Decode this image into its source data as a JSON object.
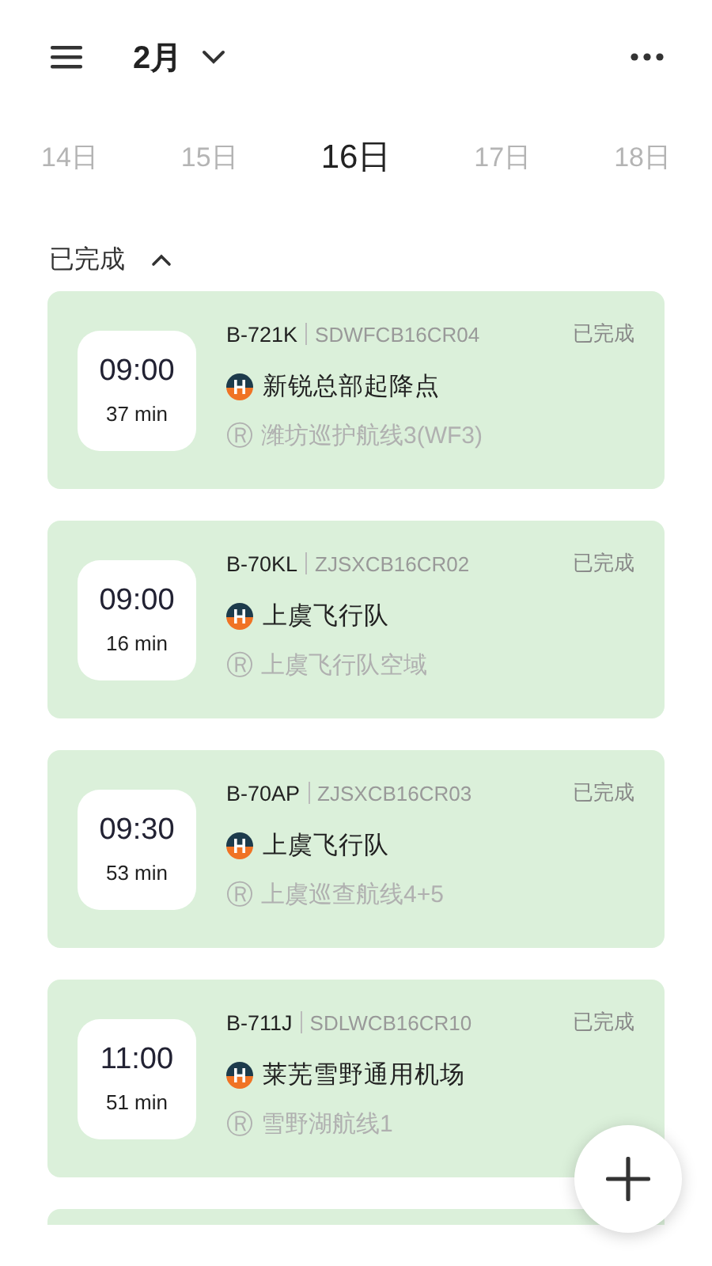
{
  "header": {
    "month": "2月"
  },
  "dates": [
    {
      "label": "14日",
      "selected": false
    },
    {
      "label": "15日",
      "selected": false
    },
    {
      "label": "16日",
      "selected": true
    },
    {
      "label": "17日",
      "selected": false
    },
    {
      "label": "18日",
      "selected": false
    }
  ],
  "section": {
    "title": "已完成",
    "expanded": true
  },
  "flights": [
    {
      "time": "09:00",
      "duration": "37 min",
      "tail": "B-721K",
      "code": "SDWFCB16CR04",
      "status": "已完成",
      "base": "新锐总部起降点",
      "route_mark": "Ⓡ",
      "route": "潍坊巡护航线3(WF3)"
    },
    {
      "time": "09:00",
      "duration": "16 min",
      "tail": "B-70KL",
      "code": "ZJSXCB16CR02",
      "status": "已完成",
      "base": "上虞飞行队",
      "route_mark": "Ⓡ",
      "route": "上虞飞行队空域"
    },
    {
      "time": "09:30",
      "duration": "53 min",
      "tail": "B-70AP",
      "code": "ZJSXCB16CR03",
      "status": "已完成",
      "base": "上虞飞行队",
      "route_mark": "Ⓡ",
      "route": "上虞巡查航线4+5"
    },
    {
      "time": "11:00",
      "duration": "51 min",
      "tail": "B-711J",
      "code": "SDLWCB16CR10",
      "status": "已完成",
      "base": "莱芜雪野通用机场",
      "route_mark": "Ⓡ",
      "route": "雪野湖航线1"
    }
  ]
}
